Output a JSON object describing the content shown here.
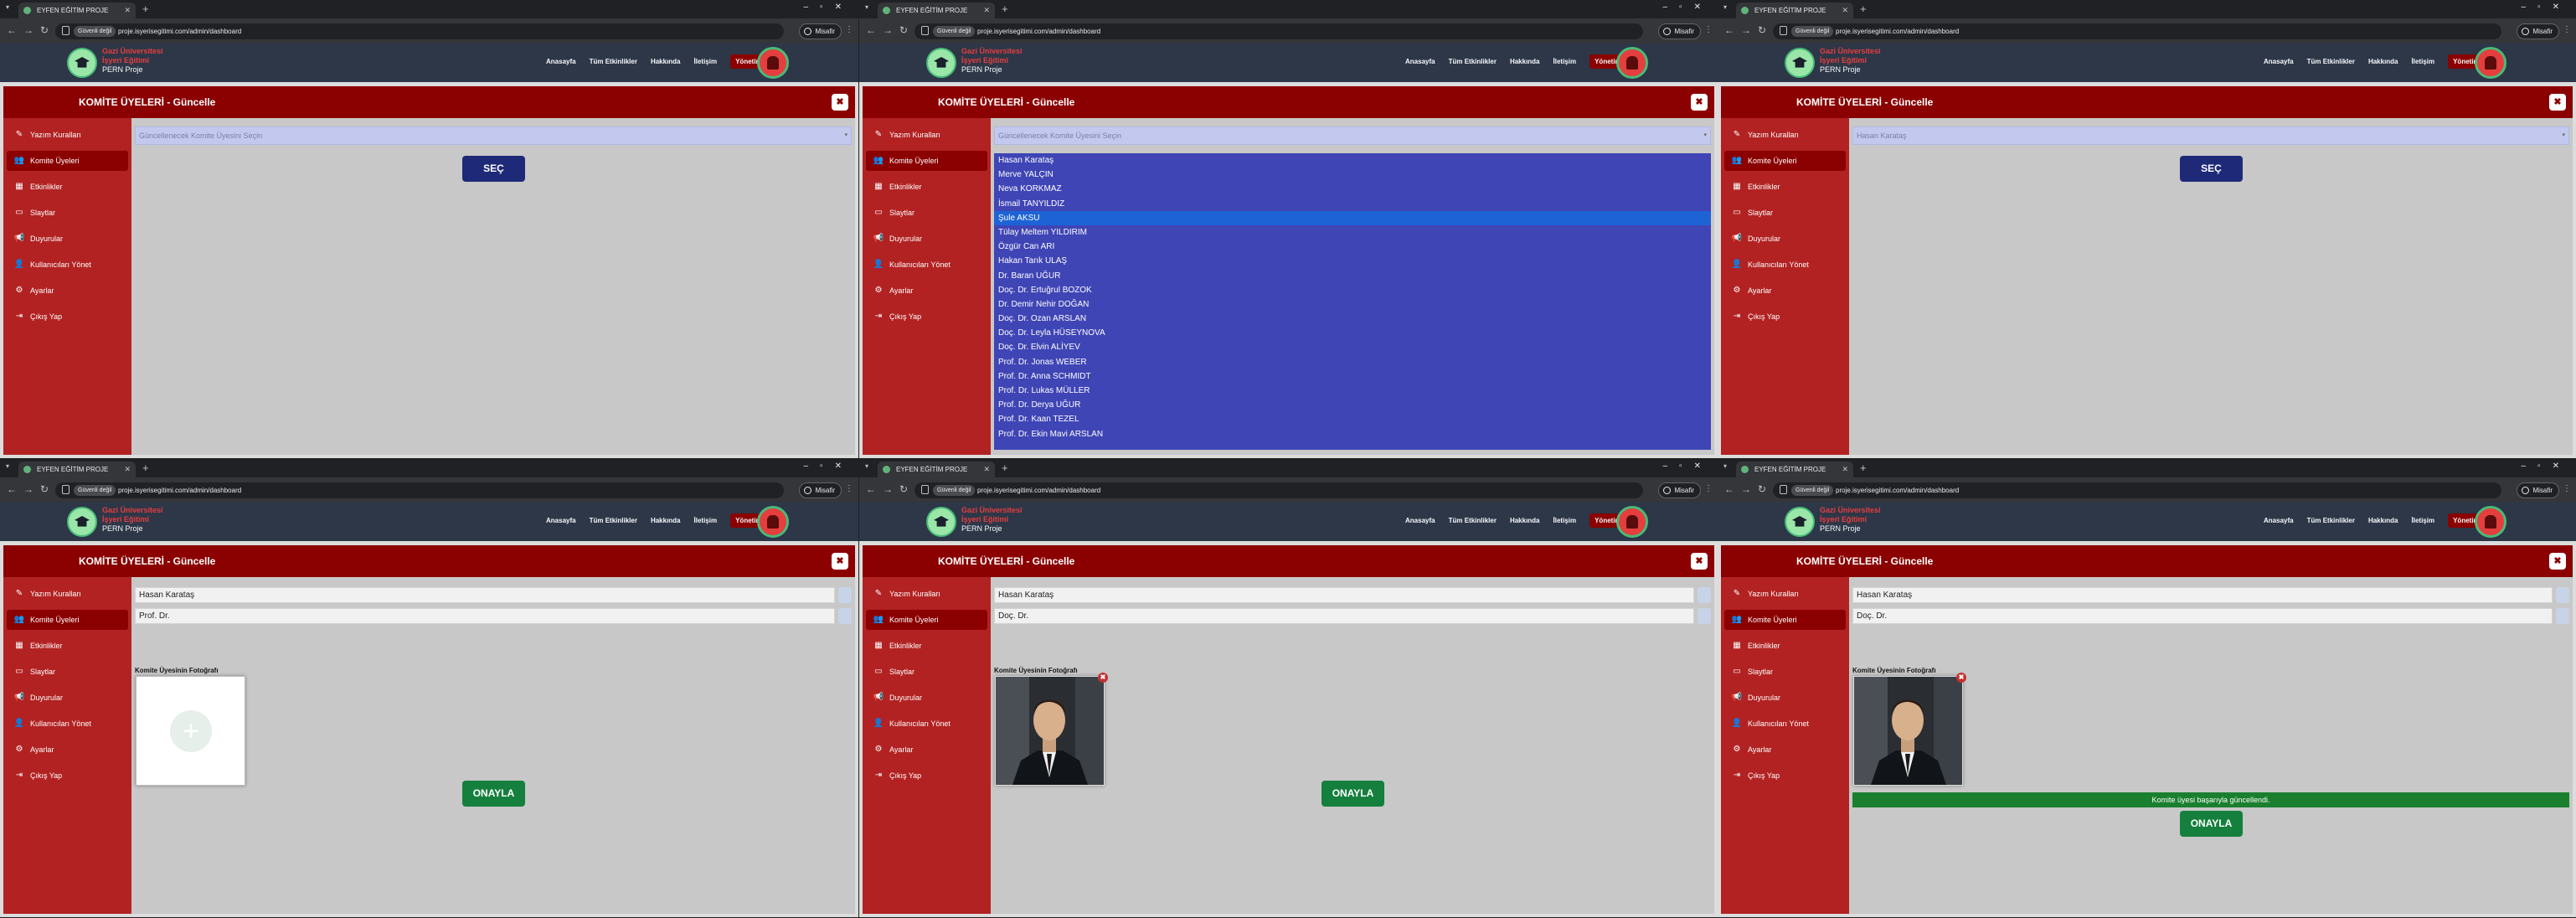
{
  "browser": {
    "tab_title": "EYFEN EĞİTİM PROJE",
    "security_badge": "Güvenli değil",
    "url": "proje.isyerisegitimi.com/admin/dashboard",
    "profile": "Misafir"
  },
  "site": {
    "brand_line1": "Gazi Üniversitesi",
    "brand_line2": "İşyeri Eğitimi",
    "brand_line3": "PERN Proje",
    "nav": [
      "Anasayfa",
      "Tüm Etkinlikler",
      "Hakkında",
      "İletişim",
      "Yönetim"
    ]
  },
  "panel": {
    "title": "KOMİTE ÜYELERİ - Güncelle",
    "close_label": "✖"
  },
  "sidebar": {
    "items": [
      {
        "label": "Yazım Kuralları",
        "icon": "feather-icon"
      },
      {
        "label": "Komite Üyeleri",
        "icon": "users-icon"
      },
      {
        "label": "Etkinlikler",
        "icon": "calendar-icon"
      },
      {
        "label": "Slaytlar",
        "icon": "monitor-icon"
      },
      {
        "label": "Duyurular",
        "icon": "megaphone-icon"
      },
      {
        "label": "Kullanıcıları Yönet",
        "icon": "user-cog-icon"
      },
      {
        "label": "Ayarlar",
        "icon": "gear-icon"
      },
      {
        "label": "Çıkış Yap",
        "icon": "logout-icon"
      }
    ],
    "active_index": 1
  },
  "select": {
    "placeholder": "Güncellenecek Komite Üyesini Seçin",
    "chosen": "Hasan Karataş",
    "button_label": "SEÇ"
  },
  "dropdown": {
    "selected_index": 4,
    "options": [
      "Hasan Karataş",
      "Merve YALÇIN",
      "Neva KORKMAZ",
      "İsmail TANYILDIZ",
      "Şule AKSU",
      "Tülay Meltem YILDIRIM",
      "Özgür Can ARI",
      "Hakan Tarık ULAŞ",
      "Dr. Baran UĞUR",
      "Doç. Dr. Ertuğrul BOZOK",
      "Dr. Demir Nehir DOĞAN",
      "Doç. Dr. Ozan ARSLAN",
      "Doç. Dr. Leyla HÜSEYNOVA",
      "Doç. Dr. Elvin ALİYEV",
      "Prof. Dr. Jonas WEBER",
      "Prof. Dr. Anna SCHMIDT",
      "Prof. Dr. Lukas MÜLLER",
      "Prof. Dr. Derya UĞUR",
      "Prof. Dr. Kaan TEZEL",
      "Prof. Dr. Ekin Mavi ARSLAN"
    ]
  },
  "edit_form": {
    "name_value": "Hasan Karataş",
    "title_value_before": "Prof. Dr.",
    "title_value_after": "Doç. Dr.",
    "photo_label": "Komite Üyesinin Fotoğrafı",
    "photo_remove": "✖",
    "upload_plus": "+",
    "confirm_label": "ONAYLA",
    "success_message": "Komite üyesi başarıyla güncellendi."
  }
}
